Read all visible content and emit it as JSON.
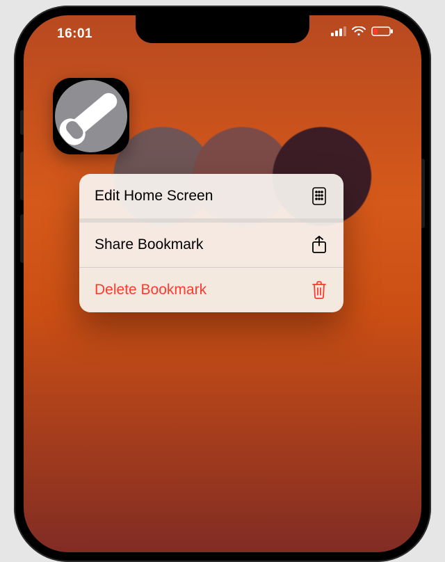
{
  "status": {
    "time": "16:01"
  },
  "app_icon": {
    "name": "wrench-settings-bookmark"
  },
  "context_menu": {
    "items": [
      {
        "label": "Edit Home Screen",
        "icon": "home-grid-icon",
        "destructive": false
      },
      {
        "label": "Share Bookmark",
        "icon": "share-icon",
        "destructive": false
      },
      {
        "label": "Delete Bookmark",
        "icon": "trash-icon",
        "destructive": true
      }
    ]
  }
}
